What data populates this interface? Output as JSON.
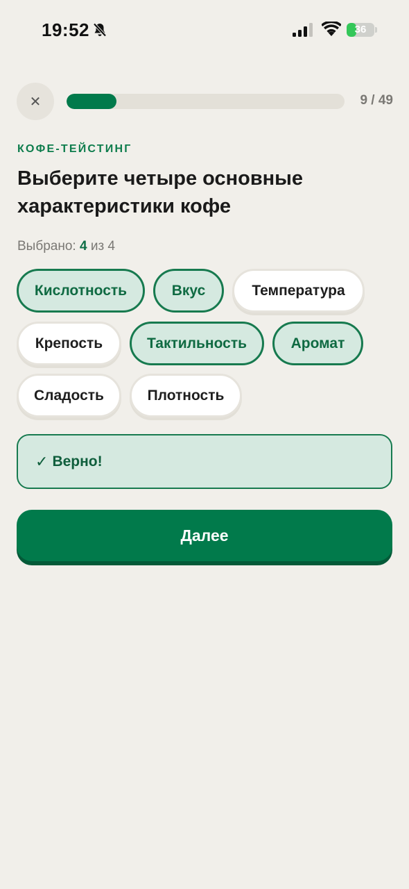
{
  "status_bar": {
    "time": "19:52",
    "battery_level": "36",
    "battery_percent": 36
  },
  "progress": {
    "counter": "9 / 49",
    "fraction": 0.18
  },
  "question": {
    "category": "КОФЕ-ТЕЙСТИНГ",
    "title": "Выберите четыре основные характеристики кофе",
    "selected_label": "Выбрано:",
    "selected_count": "4",
    "selected_of": "из 4"
  },
  "options": [
    {
      "label": "Кислотность",
      "selected": true
    },
    {
      "label": "Вкус",
      "selected": true
    },
    {
      "label": "Температура",
      "selected": false
    },
    {
      "label": "Крепость",
      "selected": false
    },
    {
      "label": "Тактильность",
      "selected": true
    },
    {
      "label": "Аромат",
      "selected": true
    },
    {
      "label": "Сладость",
      "selected": false
    },
    {
      "label": "Плотность",
      "selected": false
    }
  ],
  "feedback": {
    "check_glyph": "✓",
    "text": "Верно!"
  },
  "actions": {
    "next_label": "Далее"
  },
  "colors": {
    "accent": "#017a4b",
    "background": "#f1efea",
    "selected_chip_bg": "#d5e9e0"
  }
}
